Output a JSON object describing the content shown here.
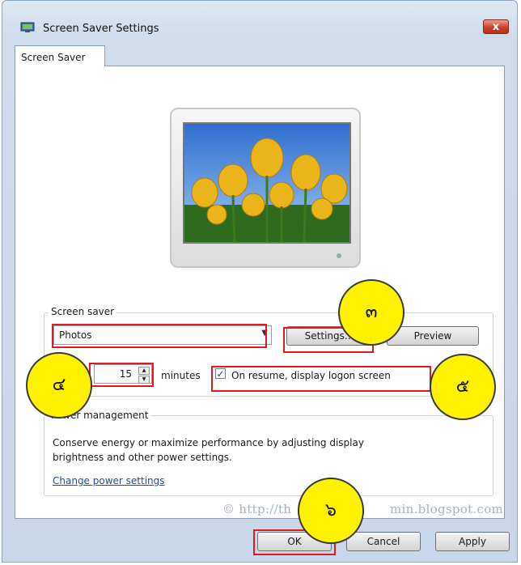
{
  "window": {
    "title": "Screen Saver Settings",
    "close_label": "x"
  },
  "tabs": [
    {
      "label": "Screen Saver"
    }
  ],
  "screen_saver": {
    "group_label": "Screen saver",
    "selected": "Photos",
    "settings_label": "Settings...",
    "preview_label": "Preview",
    "wait_value": "15",
    "minutes_label": "minutes",
    "resume_label": "On resume, display logon screen",
    "resume_checked": true
  },
  "power": {
    "group_label": "Power management",
    "description_line1": "Conserve energy or maximize performance by adjusting display",
    "description_line2": "brightness and other power settings.",
    "link": "Change power settings"
  },
  "buttons": {
    "ok": "OK",
    "cancel": "Cancel",
    "apply": "Apply"
  },
  "markers": {
    "m3": "๓",
    "m4": "๔",
    "m5": "๕",
    "m6": "๖"
  },
  "watermark": "© http://th",
  "watermark_tail": "min.blogspot.com"
}
